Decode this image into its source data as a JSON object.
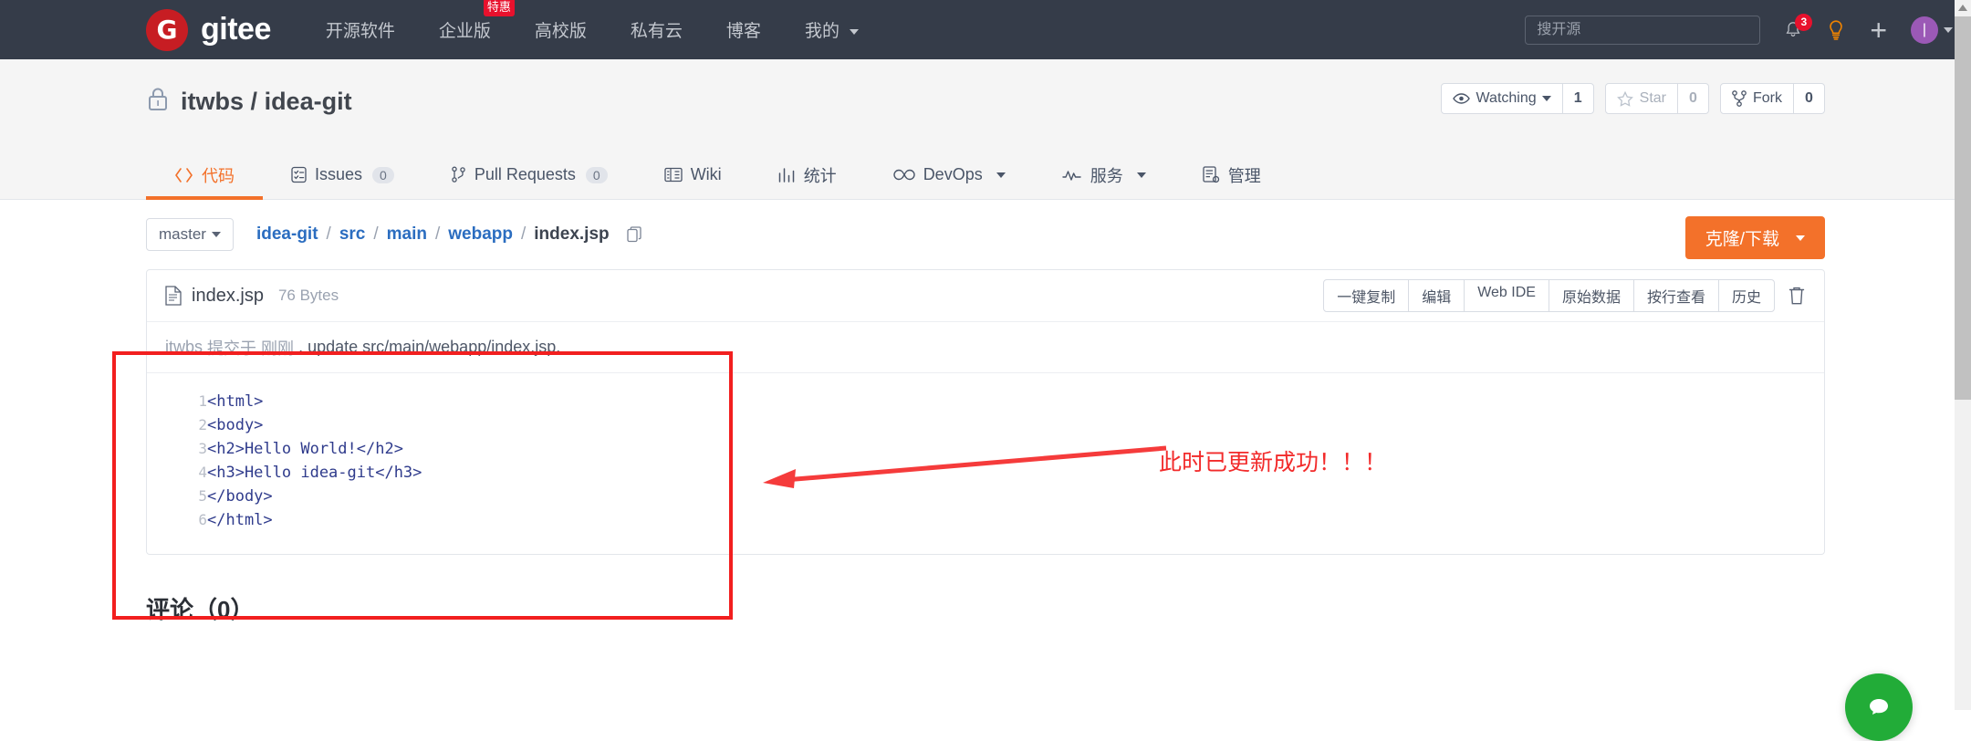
{
  "navbar": {
    "brand_mark": "G",
    "brand_text": "gitee",
    "links": [
      {
        "label": "开源软件",
        "badge": null,
        "caret": false
      },
      {
        "label": "企业版",
        "badge": "特惠",
        "caret": false
      },
      {
        "label": "高校版",
        "badge": null,
        "caret": false
      },
      {
        "label": "私有云",
        "badge": null,
        "caret": false
      },
      {
        "label": "博客",
        "badge": null,
        "caret": false
      },
      {
        "label": "我的",
        "badge": null,
        "caret": true
      }
    ],
    "search_placeholder": "搜开源",
    "search_value": "",
    "notification_count": "3",
    "icons": [
      "bell-icon",
      "lightbulb-icon",
      "plus-icon",
      "avatar"
    ],
    "bg_color": "#353c49",
    "badge_color": "#e8112d"
  },
  "repo": {
    "owner": "itwbs",
    "separator": "/",
    "name": "idea-git",
    "visibility_icon": "lock-icon",
    "watch": {
      "label": "Watching",
      "count": "1"
    },
    "star": {
      "label": "Star",
      "count": "0"
    },
    "fork": {
      "label": "Fork",
      "count": "0"
    }
  },
  "tabs": [
    {
      "label": "代码",
      "icon": "code-icon",
      "count": null,
      "active": true,
      "caret": false
    },
    {
      "label": "Issues",
      "icon": "issue-icon",
      "count": "0",
      "active": false,
      "caret": false
    },
    {
      "label": "Pull Requests",
      "icon": "pull-request-icon",
      "count": "0",
      "active": false,
      "caret": false
    },
    {
      "label": "Wiki",
      "icon": "book-icon",
      "count": null,
      "active": false,
      "caret": false
    },
    {
      "label": "统计",
      "icon": "chart-icon",
      "count": null,
      "active": false,
      "caret": false
    },
    {
      "label": "DevOps",
      "icon": "infinity-icon",
      "count": null,
      "active": false,
      "caret": true
    },
    {
      "label": "服务",
      "icon": "pulse-icon",
      "count": null,
      "active": false,
      "caret": true
    },
    {
      "label": "管理",
      "icon": "settings-doc-icon",
      "count": null,
      "active": false,
      "caret": false
    }
  ],
  "breadcrumb": {
    "branch": "master",
    "parts": [
      {
        "label": "idea-git",
        "link": true
      },
      {
        "label": "src",
        "link": true
      },
      {
        "label": "main",
        "link": true
      },
      {
        "label": "webapp",
        "link": true
      },
      {
        "label": "index.jsp",
        "link": false
      }
    ],
    "separator": "/",
    "copy_icon": "copy-icon",
    "clone_button": "克隆/下载",
    "clone_color": "#f3712a"
  },
  "file": {
    "icon": "file-icon",
    "name": "index.jsp",
    "size": "76 Bytes",
    "actions": [
      "一键复制",
      "编辑",
      "Web IDE",
      "原始数据",
      "按行查看",
      "历史"
    ],
    "delete_icon": "trash-icon",
    "commit": {
      "author": "itwbs",
      "verb": "提交于",
      "when": "刚刚",
      "dot": ".",
      "message": "update src/main/webapp/index.jsp."
    },
    "code_lines": [
      {
        "n": "1",
        "text": "<html>"
      },
      {
        "n": "2",
        "text": "<body>"
      },
      {
        "n": "3",
        "text": "<h2>Hello World!</h2>"
      },
      {
        "n": "4",
        "text": "<h3>Hello idea-git</h3>"
      },
      {
        "n": "5",
        "text": "</body>"
      },
      {
        "n": "6",
        "text": "</html>"
      }
    ]
  },
  "comments": {
    "title": "评论（0）"
  },
  "annotation": {
    "text": "此时已更新成功！！！",
    "color": "#f22b2b",
    "shape": "rectangle-and-arrow"
  },
  "fab": {
    "name": "help-chat-button",
    "color": "#22ac38"
  }
}
